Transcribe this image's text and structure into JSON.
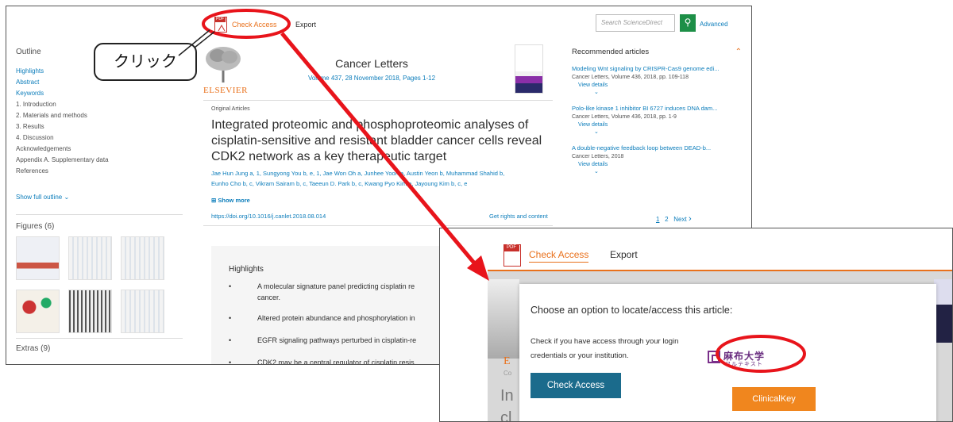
{
  "toolbar": {
    "check_access": "Check Access",
    "export": "Export",
    "search_placeholder": "Search ScienceDirect",
    "search_icon": "search-icon",
    "advanced": "Advanced"
  },
  "outline": {
    "title": "Outline",
    "links": [
      "Highlights",
      "Abstract",
      "Keywords"
    ],
    "sections": [
      "1. Introduction",
      "2. Materials and methods",
      "3. Results",
      "4. Discussion",
      "Acknowledgements",
      "Appendix A. Supplementary data",
      "References"
    ],
    "show_full": "Show full outline",
    "figures": "Figures (6)",
    "extras": "Extras (9)"
  },
  "journal": {
    "publisher": "ELSEVIER",
    "name": "Cancer Letters",
    "volume": "Volume 437, 28 November 2018, Pages 1-12"
  },
  "article": {
    "type": "Original Articles",
    "title": "Integrated proteomic and phosphoproteomic analyses of cisplatin-sensitive and resistant bladder cancer cells reveal CDK2 network as a key therapeutic target",
    "authors_line1": "Jae Hun Jung a, 1, Sungyong You b, e, 1, Jae Won Oh a, Junhee Yoon a, Austin Yeon b, Muhammad Shahid b,",
    "authors_line2": "Eunho Cho b, c, Vikram Sairam b, c, Taeeun D. Park b, c, Kwang Pyo Kim a, Jayoung Kim b, c, e",
    "show_more": "Show more",
    "doi": "https://doi.org/10.1016/j.canlet.2018.08.014",
    "rights": "Get rights and content"
  },
  "highlights": {
    "title": "Highlights",
    "items": [
      "A molecular signature panel predicting cisplatin re",
      "cancer.",
      "Altered protein abundance and phosphorylation in",
      "EGFR signaling pathways perturbed in cisplatin-re",
      "CDK2 may be a central regulator of cisplatin resis"
    ]
  },
  "recommended": {
    "title": "Recommended articles",
    "items": [
      {
        "title": "Modeling Wnt signaling by CRISPR-Cas9 genome edi...",
        "source": "Cancer Letters, Volume 436, 2018, pp. 109-118",
        "view": "View details"
      },
      {
        "title": "Polo-like kinase 1 inhibitor BI 6727 induces DNA dam...",
        "source": "Cancer Letters, Volume 436, 2018, pp. 1-9",
        "view": "View details"
      },
      {
        "title": "A double-negative feedback loop between DEAD-b...",
        "source": "Cancer Letters, 2018",
        "view": "View details"
      }
    ],
    "page1": "1",
    "page2": "2",
    "next": "Next"
  },
  "callout": {
    "text": "クリック"
  },
  "zoom": {
    "check_access": "Check Access",
    "export": "Export",
    "popup_title": "Choose an option to locate/access this article:",
    "popup_text": "Check if you have access through your login credentials or your institution.",
    "popup_button": "Check Access",
    "univ_logo_line1": "麻布大学",
    "univ_logo_line2": "フルテキスト",
    "clinicalkey": "ClinicalKey",
    "partial_E": "E",
    "partial_In": "In",
    "partial_cl": "cl",
    "partial_co": "Co"
  },
  "colors": {
    "accent_orange": "#e9711c",
    "link_blue": "#0c7dbb",
    "search_green": "#1d8f47",
    "annotation_red": "#e8141b",
    "button_teal": "#1b6b8c",
    "clinicalkey_orange": "#f0861e"
  }
}
